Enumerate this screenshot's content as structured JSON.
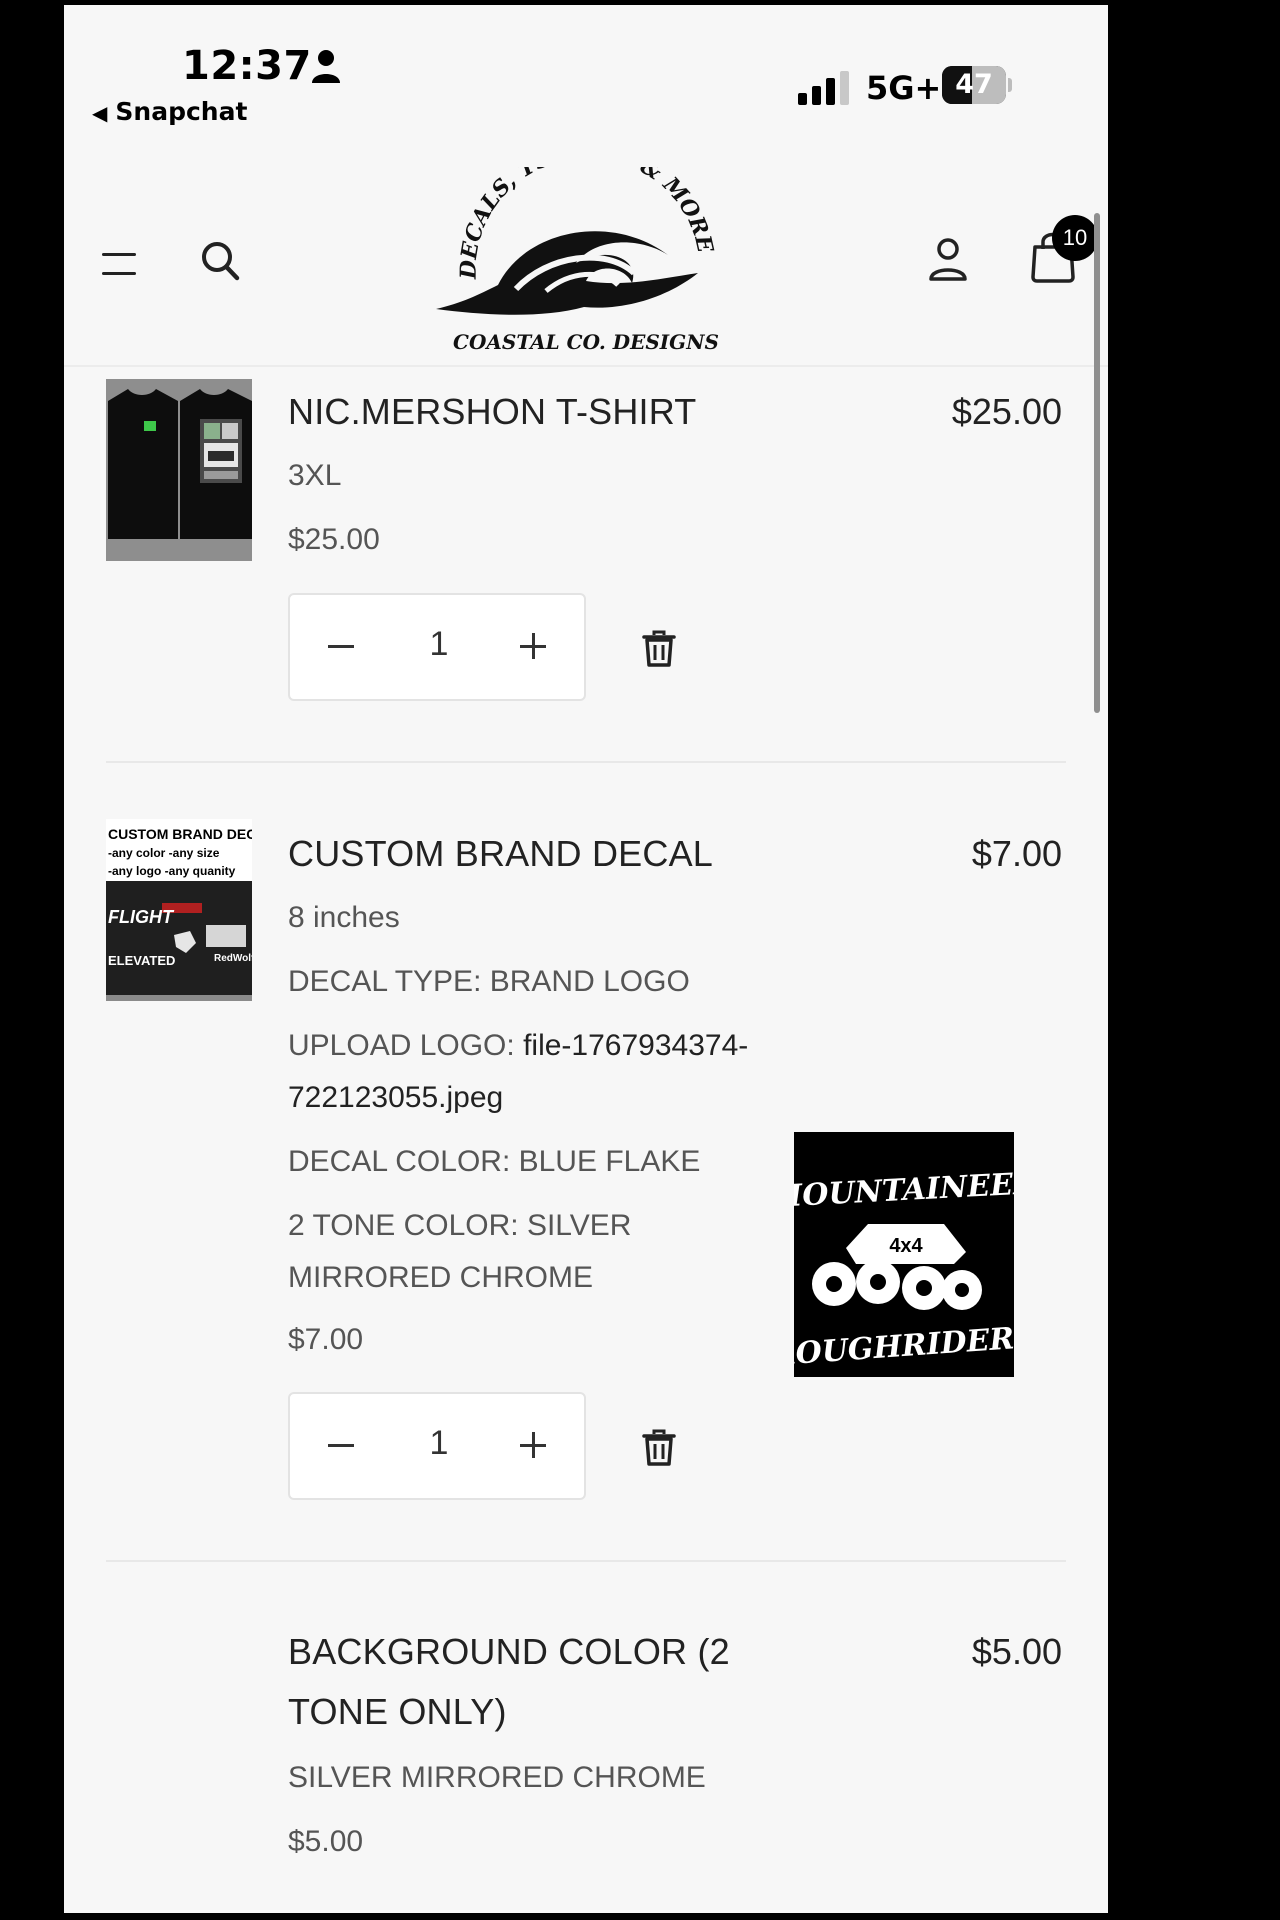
{
  "status_bar": {
    "time": "12:37",
    "back_app": "Snapchat",
    "network": "5G+",
    "battery": "47"
  },
  "header": {
    "cart_count": "10",
    "logo_top": "DECALS, TSHIRTS & MORE!",
    "logo_bottom": "COASTAL CO. DESIGNS"
  },
  "items": [
    {
      "title": "NIC.MERSHON T-SHIRT",
      "price": "$25.00",
      "size": "3XL",
      "unit_price": "$25.00",
      "quantity": "1"
    },
    {
      "title": "CUSTOM BRAND DECAL",
      "price": "$7.00",
      "size": "8 inches",
      "decal_type": "DECAL TYPE: BRAND LOGO",
      "upload_label": "UPLOAD LOGO: ",
      "upload_file_a": "file-1767934374-",
      "upload_file_b": "722123055.jpeg",
      "decal_color": "DECAL COLOR: BLUE FLAKE",
      "tone_a": "2 TONE COLOR: SILVER",
      "tone_b": "MIRRORED CHROME",
      "unit_price": "$7.00",
      "quantity": "1",
      "thumb_text": [
        "CUSTOM BRAND DECALS",
        "-any color  -any size",
        "-any logo  -any quanity",
        "FLIGHT",
        "ELEVATED",
        "RedWolf"
      ],
      "preview_text": [
        "MOUNTAINEER",
        "4x4",
        "ROUGHRIDERS"
      ]
    },
    {
      "title_a": "BACKGROUND COLOR (2",
      "title_b": "TONE ONLY)",
      "price": "$5.00",
      "variant": "SILVER MIRRORED CHROME",
      "unit_price": "$5.00"
    }
  ],
  "icons": [
    "menu-icon",
    "search-icon",
    "account-icon",
    "bag-icon",
    "trash-icon"
  ]
}
